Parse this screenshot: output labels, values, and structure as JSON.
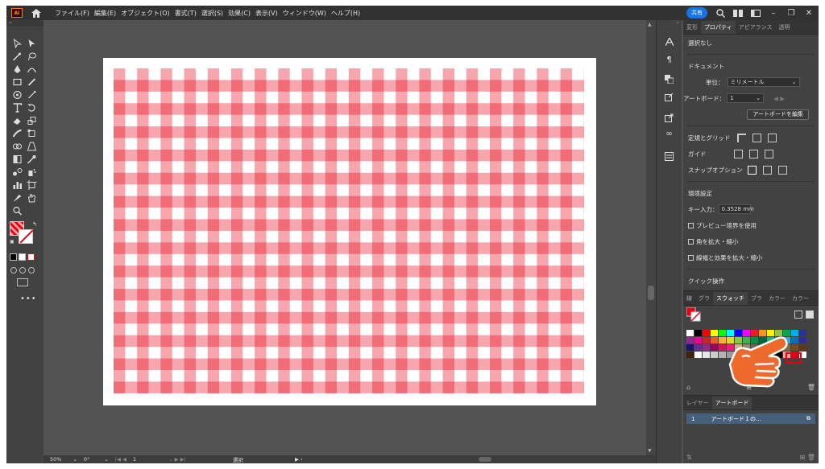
{
  "menubar": {
    "logo": "Ai",
    "items": [
      "ファイル(F)",
      "編集(E)",
      "オブジェクト(O)",
      "書式(T)",
      "選択(S)",
      "効果(C)",
      "表示(V)",
      "ウィンドウ(W)",
      "ヘルプ(H)"
    ],
    "share_label": "共有"
  },
  "status": {
    "zoom": "50%",
    "rotation": "0°",
    "artboard_num": "1",
    "tool_label": "選択"
  },
  "properties": {
    "tabs": [
      "変形",
      "プロパティ",
      "アピアランス",
      "透明"
    ],
    "active_tab": "プロパティ",
    "selection": "選択なし",
    "document_heading": "ドキュメント",
    "units_label": "単位：",
    "units_value": "ミリメートル",
    "artboard_label": "アートボード：",
    "artboard_value": "1",
    "edit_artboard_button": "アートボードを編集",
    "rulers_grid_label": "定規とグリッド",
    "guides_label": "ガイド",
    "snap_label": "スナップオプション",
    "preferences_heading": "環境設定",
    "key_increment_label": "キー入力：",
    "key_increment_value": "0.3528 mm",
    "checkboxes": [
      "プレビュー境界を使用",
      "角を拡大・縮小",
      "線幅と効果を拡大・縮小"
    ],
    "quick_actions_heading": "クイック操作"
  },
  "swatches": {
    "tabs": [
      "線",
      "グラ",
      "スウォッチ",
      "ブラ",
      "カラー",
      "カラー"
    ],
    "active_tab": "スウォッチ",
    "colors": [
      "#ffffff",
      "#000000",
      "#ff0000",
      "#ffff00",
      "#00ff00",
      "#00ffff",
      "#0000ff",
      "#ff00ff",
      "#ed1c24",
      "#f7941d",
      "#fff200",
      "#8dc63f",
      "#00a651",
      "#00aeef",
      "#2e3192",
      "#92278f",
      "#ec008c",
      "#c1272d",
      "#f15a24",
      "#fbb03b",
      "#d9e021",
      "#8cc63f",
      "#39b54a",
      "#009245",
      "#006837",
      "#22b573",
      "#00a99d",
      "#29abe2",
      "#0071bc",
      "#2e3192",
      "#1b1464",
      "#662d91",
      "#93278f",
      "#9e005d",
      "#d4145a",
      "#ed1e79",
      "#c7b299",
      "#998675",
      "#736357",
      "#534741",
      "#c69c6d",
      "#a67c52",
      "#8c6239",
      "#754c24",
      "#603813",
      "#42210b",
      "#ffffff",
      "#e6e6e6",
      "#cccccc",
      "#b3b3b3",
      "#999999",
      "#808080",
      "#666666",
      "#4d4d4d",
      "#333333",
      "#1a1a1a",
      "#000000",
      "#ff9c9c",
      "#e50012",
      "#ffffff"
    ]
  },
  "layers": {
    "tabs": [
      "レイヤー",
      "アートボード"
    ],
    "active_tab": "アートボード",
    "row_number": "1",
    "row_name": "アートボード１の..."
  },
  "colors": {
    "accent_red": "#e50012",
    "light_red": "#ff9c9c",
    "share_blue": "#1473e6",
    "pointer_orange": "#ee6a2c"
  }
}
